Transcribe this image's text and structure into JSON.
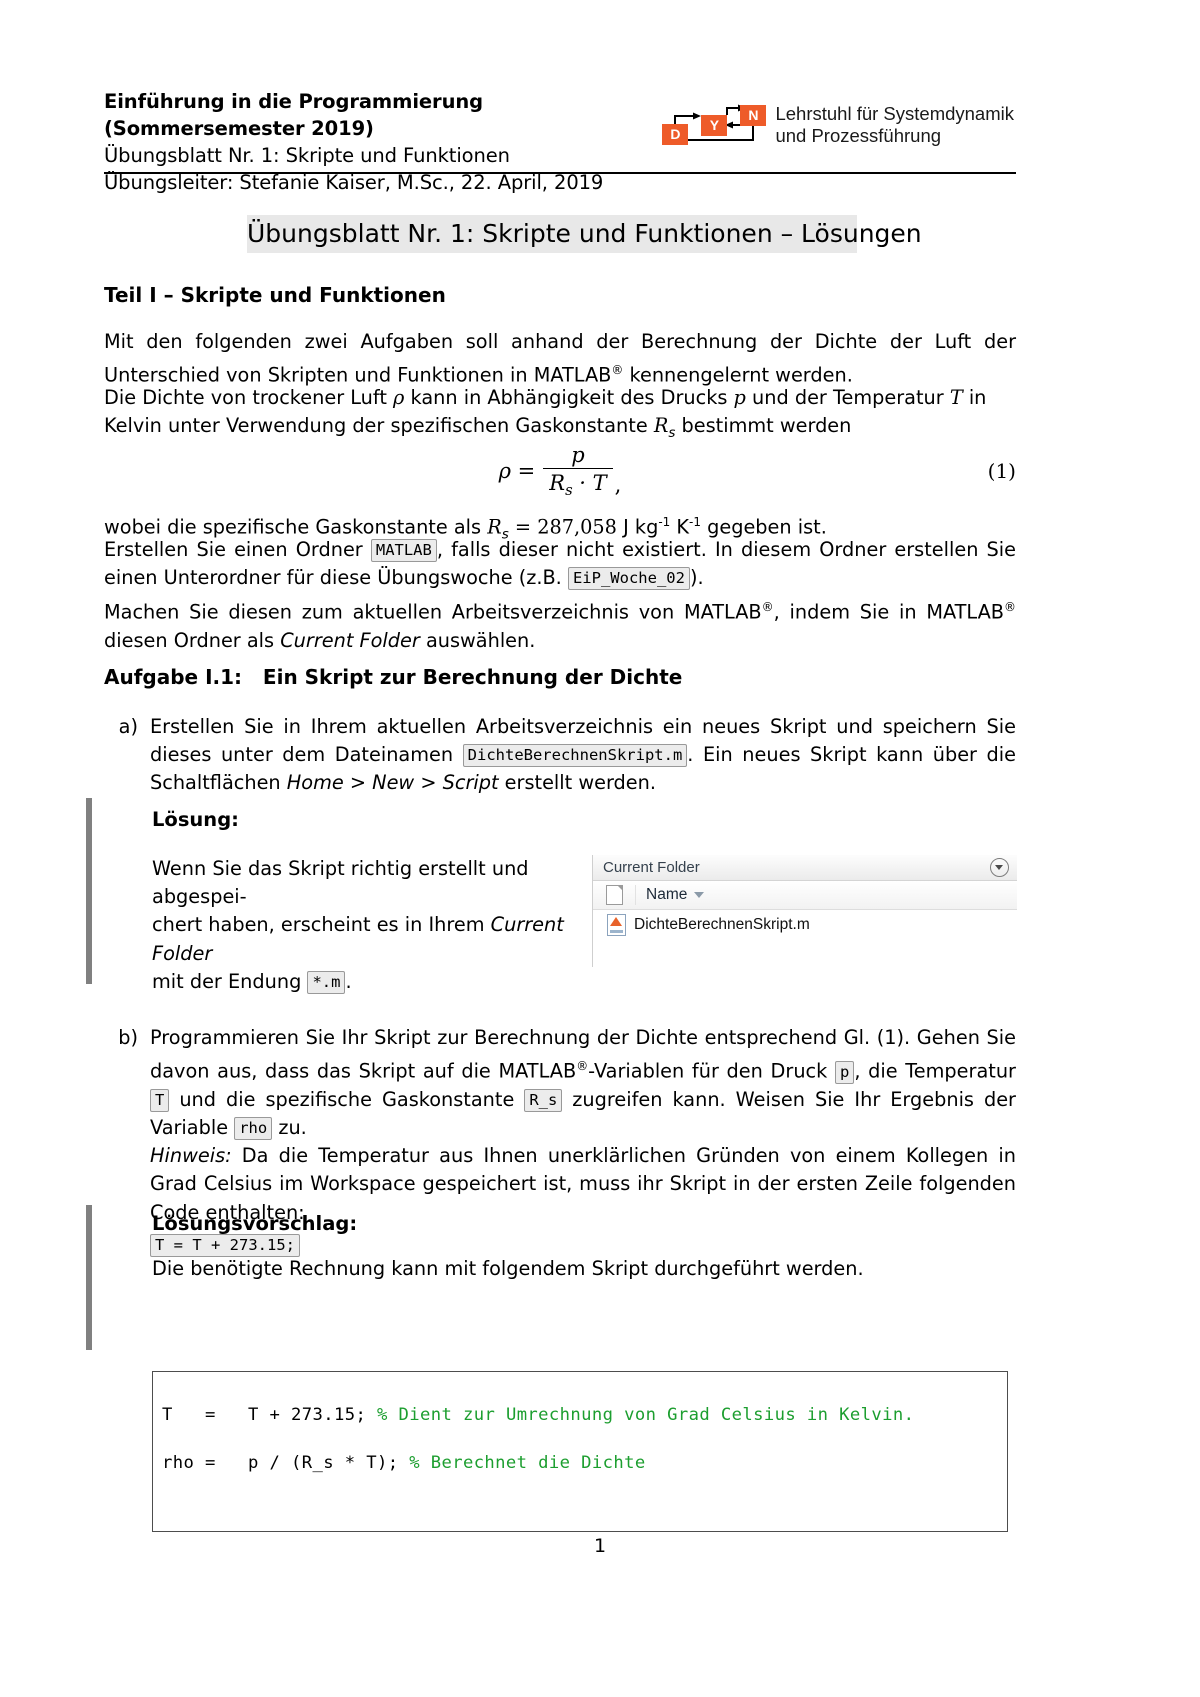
{
  "header": {
    "line1": "Einführung in die Programmierung (Sommersemester 2019)",
    "line2": "Übungsblatt Nr. 1: Skripte und Funktionen",
    "line3": "Übungsleiter: Stefanie Kaiser, M.Sc., 22. April, 2019",
    "logo": {
      "box_d": "D",
      "box_y": "Y",
      "box_n": "N",
      "text_line1": "Lehrstuhl für Systemdynamik",
      "text_line2": "und Prozessführung",
      "accent_color": "#EE5B29"
    }
  },
  "doc_title": "Übungsblatt Nr. 1: Skripte und Funktionen – Lösungen",
  "section": {
    "heading": "Teil I – Skripte und Funktionen",
    "p1_a": "Mit den folgenden zwei Aufgaben soll anhand der Berechnung der Dichte der Luft der Unterschied von Skripten und Funktionen in MATLAB",
    "p1_reg": "®",
    "p1_b": " kennengelernt werden.",
    "p2_a": "Die Dichte von trockener Luft ",
    "p2_rho": "ρ",
    "p2_b": " kann in Abhängigkeit des Drucks ",
    "p2_p": "p",
    "p2_c": " und der Temperatur ",
    "p2_T": "T",
    "p2_d": " in Kelvin unter Verwendung der spezifischen Gaskonstante ",
    "p2_Rs": "R",
    "p2_Rs_sub": "s",
    "p2_e": " bestimmt werden"
  },
  "equation": {
    "lhs": "ρ =",
    "numerator": "p",
    "denominator": "R",
    "denominator_sub": "s",
    "denominator_rest": " · T",
    "comma": ",",
    "number": "(1)"
  },
  "after_eq": {
    "l1_a": "wobei die spezifische Gaskonstante als ",
    "l1_Rs": "R",
    "l1_Rs_sub": "s",
    "l1_eq": " = 287,058",
    "l1_units_j": "J kg",
    "l1_units_sup1": "-1",
    "l1_units_k": "K",
    "l1_units_sup2": "-1",
    "l1_b": " gegeben ist.",
    "l2_a": "Erstellen Sie einen Ordner ",
    "l2_chip": "MATLAB",
    "l2_b": ", falls dieser nicht existiert. In diesem Ordner erstellen Sie einen Unterordner für diese Übungswoche (z.B. ",
    "l2_chip2": "EiP_Woche_02",
    "l2_c": ").",
    "l3_a": "Machen Sie diesen zum aktuellen Arbeitsverzeichnis von MATLAB",
    "l3_reg1": "®",
    "l3_b": ", indem Sie in MATLAB",
    "l3_reg2": "®",
    "l3_c": " diesen Ordner als ",
    "l3_it": "Current Folder",
    "l3_d": " auswählen."
  },
  "task": {
    "heading_label": "Aufgabe I.1:",
    "heading_title": "Ein Skript zur Berechnung der Dichte",
    "a": {
      "marker": "a)",
      "t1": "Erstellen Sie in Ihrem aktuellen Arbeitsverzeichnis ein neues Skript und speichern Sie dieses unter dem Dateinamen ",
      "chip": "DichteBerechnenSkript.m",
      "t2": ". Ein neues Skript kann über die Schaltflächen ",
      "it1": "Home > New > Script",
      "t3": " erstellt werden."
    },
    "a_solution": {
      "head": "Lösung:",
      "t1": "Wenn Sie das Skript richtig erstellt und abgespei-",
      "t2": "chert haben, erscheint es in Ihrem ",
      "t2_it": "Current Folder",
      "t3": "mit der Endung ",
      "chip": "*.m",
      "t4": "."
    },
    "b": {
      "marker": "b)",
      "t1": "Programmieren Sie Ihr Skript zur Berechnung der Dichte entsprechend Gl. (1). Gehen Sie davon aus, dass das Skript auf die MATLAB",
      "reg": "®",
      "t2": "-Variablen für den Druck ",
      "chip_p": "p",
      "t3": ", die Temperatur ",
      "chip_T": "T",
      "t4": " und die spezifische Gaskonstante ",
      "chip_Rs": "R_s",
      "t5": " zugreifen kann. Weisen Sie Ihr Ergebnis der Variable ",
      "chip_rho": "rho",
      "t6": " zu.",
      "hint_label": "Hinweis:",
      "hint_text": " Da die Temperatur aus Ihnen unerklärlichen Gründen von einem Kollegen in Grad Celsius im Workspace gespeichert ist, muss ihr Skript in der ersten Zeile folgenden Code enthalten:",
      "hint_chip": "T = T + 273.15;"
    },
    "b_solution": {
      "head": "Lösungsvorschlag:",
      "intro": "Die benötigte Rechnung kann mit folgendem Skript durchgeführt werden.",
      "code_lines": [
        {
          "code": "T   =   T + 273.15; ",
          "comment": "% Dient zur Umrechnung von Grad Celsius in Kelvin."
        },
        {
          "code": "rho =   p / (R_s * T); ",
          "comment": "% Berechnet die Dichte"
        }
      ],
      "comment_color": "#1c9e2f"
    }
  },
  "current_folder_panel": {
    "title": "Current Folder",
    "column_header": "Name",
    "file_name": "DichteBerechnenSkript.m"
  },
  "page_number": "1"
}
